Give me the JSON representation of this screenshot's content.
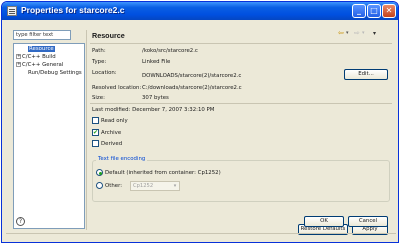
{
  "window": {
    "title": "Properties for starcore2.c",
    "minimize_icon": "minimize-icon",
    "maximize_icon": "maximize-icon",
    "close_icon": "close-icon"
  },
  "filter": {
    "placeholder": "type filter text",
    "value": "type filter text"
  },
  "tree": {
    "items": [
      {
        "label": "Resource",
        "selected": true,
        "expandable": false
      },
      {
        "label": "C/C++ Build",
        "selected": false,
        "expandable": true,
        "expander": "+"
      },
      {
        "label": "C/C++ General",
        "selected": false,
        "expandable": true,
        "expander": "+"
      },
      {
        "label": "Run/Debug Settings",
        "selected": false,
        "expandable": false
      }
    ]
  },
  "header": {
    "title": "Resource",
    "back_icon": "back-arrow-icon",
    "forward_icon": "forward-arrow-icon",
    "menu_icon": "view-menu-icon"
  },
  "resource": {
    "path_label": "Path:",
    "path_value": "/koko/src/starcore2.c",
    "type_label": "Type:",
    "type_value": "Linked File",
    "location_label": "Location:",
    "location_value": "DOWNLOADS/starcore(2)/starcore2.c",
    "edit_label": "Edit...",
    "resolved_label": "Resolved location:",
    "resolved_value": "C:/downloads/starcore(2)/starcore2.c",
    "size_label": "Size:",
    "size_value": "307  bytes",
    "last_modified_label": "Last modified:",
    "last_modified_value": "December 7, 2007 3:32:10 PM"
  },
  "attributes": {
    "read_only": {
      "label": "Read only",
      "checked": false
    },
    "archive": {
      "label": "Archive",
      "checked": true
    },
    "derived": {
      "label": "Derived",
      "checked": false
    }
  },
  "encoding": {
    "group_title": "Text file encoding",
    "default_label": "Default (inherited from container: Cp1252)",
    "default_selected": true,
    "other_label": "Other:",
    "other_selected": false,
    "other_value": "Cp1252"
  },
  "buttons": {
    "restore_defaults": "Restore Defaults",
    "apply": "Apply",
    "ok": "OK",
    "cancel": "Cancel",
    "help_icon": "help-icon"
  },
  "colors": {
    "titlebar": "#0050e0",
    "selection": "#316ac5",
    "dialog_bg": "#ece9d8",
    "group_title": "#0046d5"
  }
}
